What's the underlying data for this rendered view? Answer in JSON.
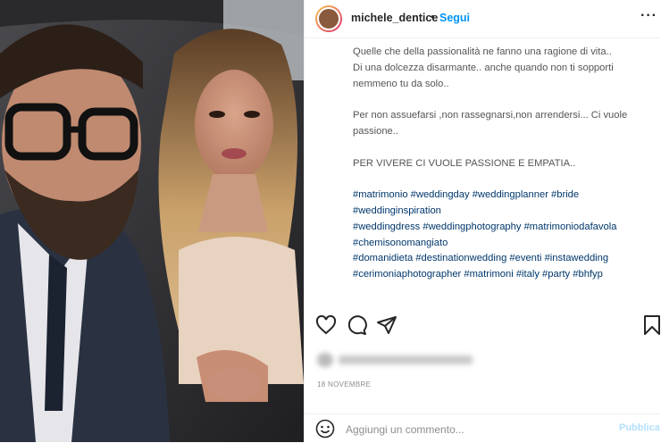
{
  "post": {
    "username": "michele_dentice",
    "separator": "•",
    "follow_label": "Segui",
    "more_label": "···"
  },
  "caption": {
    "line1": "Quelle che della passionalità ne fanno una ragione di vita..",
    "line2": "Di una dolcezza disarmante.. anche quando non ti sopporti",
    "line3": "nemmeno tu da solo..",
    "line4": "Per non assuefarsi ,non rassegnarsi,non arrendersi... Ci vuole",
    "line5": "passione..",
    "line6": "PER VIVERE CI VUOLE PASSIONE E EMPATIA..",
    "tags1": "#matrimonio #weddingday #weddingplanner #bride",
    "tags2": "#weddinginspiration",
    "tags3": "#weddingdress #weddingphotography #matrimoniodafavola",
    "tags4": "#chemisonomangiato",
    "tags5": "#domanidieta #destinationwedding #eventi #instawedding",
    "tags6": "#cerimoniaphotographer #matrimoni #italy #party #bhfyp"
  },
  "actions": {
    "like_icon": "heart-icon",
    "comment_icon": "comment-icon",
    "share_icon": "send-icon",
    "save_icon": "bookmark-icon"
  },
  "date": "18 NOVEMBRE",
  "comment_box": {
    "placeholder": "Aggiungi un commento...",
    "publish_label": "Pubblica"
  },
  "colors": {
    "link": "#0095f6",
    "hashtag": "#00376b",
    "publish_disabled": "#b2dffc"
  }
}
